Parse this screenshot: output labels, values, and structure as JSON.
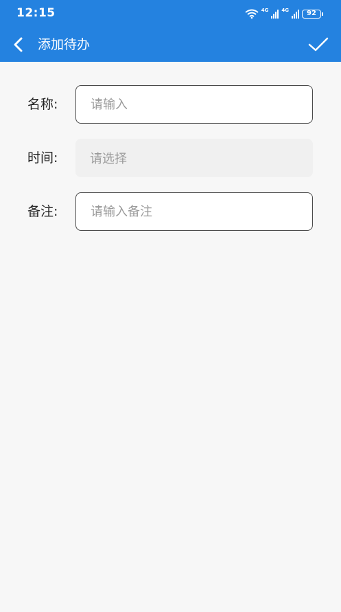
{
  "status_bar": {
    "time": "12:15",
    "network_1": "4G",
    "network_2": "4G",
    "battery": "92",
    "icons": [
      "wifi-icon",
      "cellular-signal-icon",
      "cellular-signal-icon",
      "battery-icon"
    ]
  },
  "header": {
    "title": "添加待办",
    "back_icon": "chevron-left-icon",
    "confirm_icon": "checkmark-icon",
    "background_color": "#2482e0"
  },
  "form": {
    "name": {
      "label": "名称:",
      "value": "",
      "placeholder": "请输入"
    },
    "time": {
      "label": "时间:",
      "placeholder": "请选择"
    },
    "note": {
      "label": "备注:",
      "value": "",
      "placeholder": "请输入备注"
    }
  }
}
